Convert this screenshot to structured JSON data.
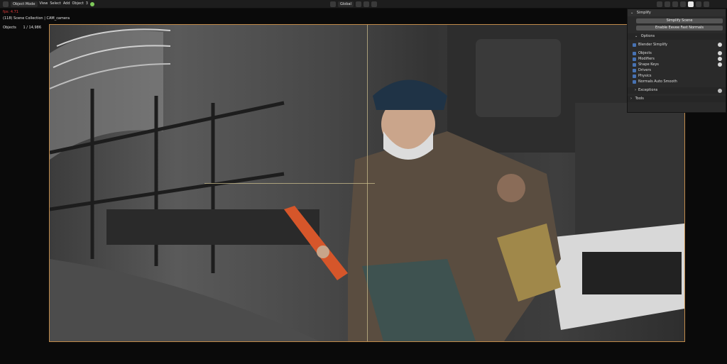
{
  "header": {
    "mode": "Object Mode",
    "menus": [
      "View",
      "Select",
      "Add",
      "Object"
    ],
    "object_count": "3",
    "orientation": "Global"
  },
  "overlay": {
    "fps": "fps: 4.71",
    "collection": "(118) Scene Collection | CAM_camera",
    "objects_label": "Objects",
    "objects_value": "1 / 14,986"
  },
  "panel": {
    "title": "Simplify",
    "simplify_scene": "Simplify Scene",
    "eevee_normals": "Enable Eevee Fast Normals",
    "options_label": "Options",
    "blender_simplify": "Blender Simplify",
    "items": [
      "Objects",
      "Modifiers",
      "Shape Keys",
      "Drivers",
      "Physics",
      "Normals Auto Smooth"
    ],
    "exceptions": "Exceptions",
    "tools": "Tools"
  },
  "colors": {
    "accent": "#4772b3",
    "fps": "#e23b3b",
    "camera_border": "#c08a4a"
  }
}
